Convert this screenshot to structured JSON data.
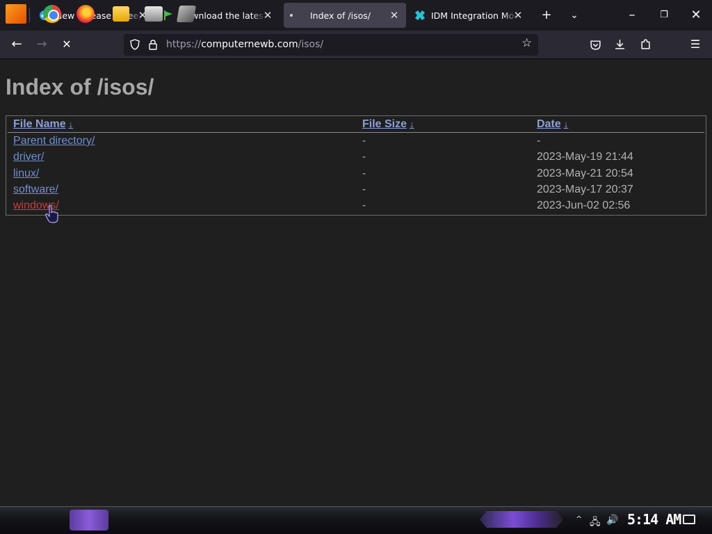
{
  "browser": {
    "tabs": [
      {
        "label": "New Release – Deepin",
        "active": false
      },
      {
        "label": "Download the latest f",
        "active": false
      },
      {
        "label": "Index of /isos/",
        "active": true
      },
      {
        "label": "IDM Integration Mod",
        "active": false
      }
    ],
    "url": {
      "scheme": "https://",
      "host": "computernewb.com",
      "path": "/isos/"
    }
  },
  "page": {
    "title": "Index of /isos/",
    "headers": {
      "name": "File Name",
      "size": "File Size",
      "date": "Date",
      "sort_arrow": "↓"
    },
    "rows": [
      {
        "name": "Parent directory/",
        "size": "-",
        "date": "-"
      },
      {
        "name": "driver/",
        "size": "-",
        "date": "2023-May-19 21:44"
      },
      {
        "name": "linux/",
        "size": "-",
        "date": "2023-May-21 20:54"
      },
      {
        "name": "software/",
        "size": "-",
        "date": "2023-May-17 20:37"
      },
      {
        "name": "windows/",
        "size": "-",
        "date": "2023-Jun-02 02:56"
      }
    ]
  },
  "taskbar": {
    "clock": "5:14 AM",
    "pinned": [
      "start-icon",
      "chrome-icon",
      "firefox-icon",
      "file-explorer-icon",
      "app-icon",
      "tool-icon"
    ]
  },
  "colors": {
    "link": "#6f90d0",
    "visited_link": "#d13a3a",
    "page_bg": "#1f1f1f"
  }
}
